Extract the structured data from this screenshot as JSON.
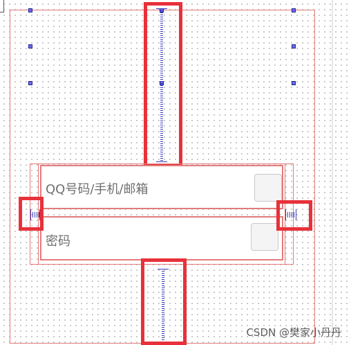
{
  "inputs": {
    "account_placeholder": "QQ号码/手机/邮箱",
    "password_placeholder": "密码"
  },
  "watermark": "CSDN @樊家小丹丹",
  "colors": {
    "highlight": "#e8313a",
    "layout_border": "#e27a7a",
    "spacer": "#3b3bb8",
    "handle": "#6b6bf0"
  }
}
